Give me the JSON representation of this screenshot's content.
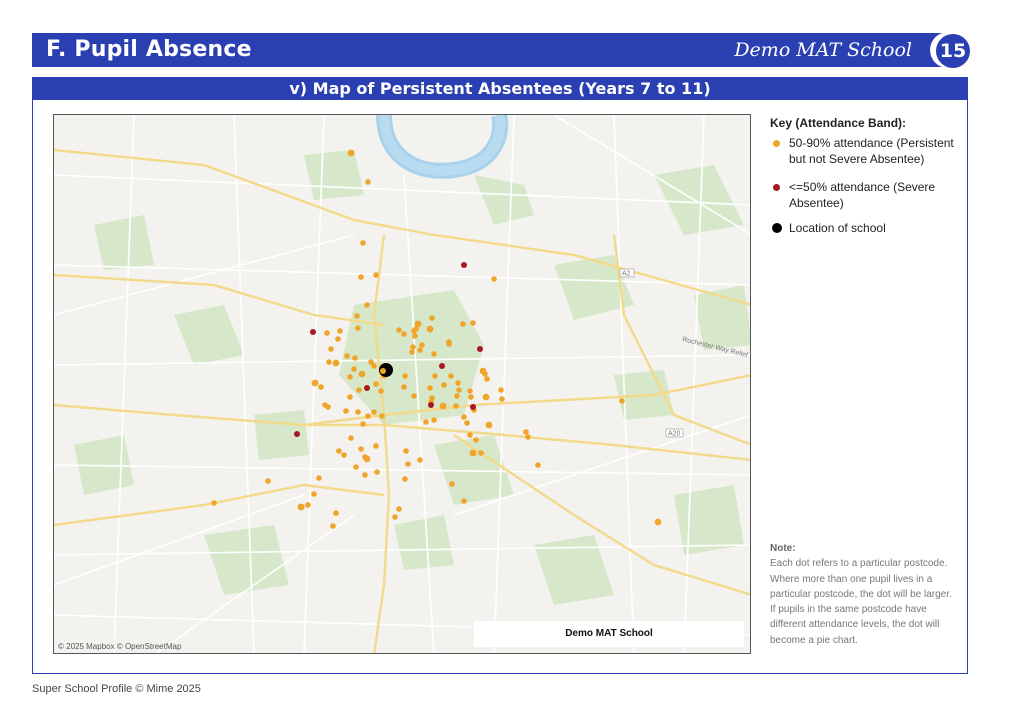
{
  "header": {
    "title": "F.  Pupil Absence",
    "school": "Demo MAT School",
    "page_number": "15"
  },
  "panel": {
    "title": "v) Map of Persistent Absentees (Years 7 to 11)"
  },
  "map": {
    "attribution": "© 2025 Mapbox © OpenStreetMap",
    "label": "Demo MAT School",
    "road_labels": [
      "A2",
      "A20",
      "Rochester Way Relief"
    ],
    "colors": {
      "orange": "#f0a52a",
      "red": "#a81820",
      "black": "#000000"
    }
  },
  "key": {
    "title": "Key (Attendance Band):",
    "items": [
      {
        "label": "50-90% attendance (Persistent but not Severe Absentee)",
        "color": "#f0a52a"
      },
      {
        "label": "<=50% attendance (Severe Absentee)",
        "color": "#a81820"
      },
      {
        "label": "Location of school",
        "color": "#000000"
      }
    ]
  },
  "note": {
    "title": "Note:",
    "text": "Each dot refers to a particular postcode. Where more than one pupil lives in a particular postcode, the dot will be larger. If pupils in the same postcode have different attendance levels, the dot will become a pie chart."
  },
  "footer": "Super School Profile © Mime 2025"
}
